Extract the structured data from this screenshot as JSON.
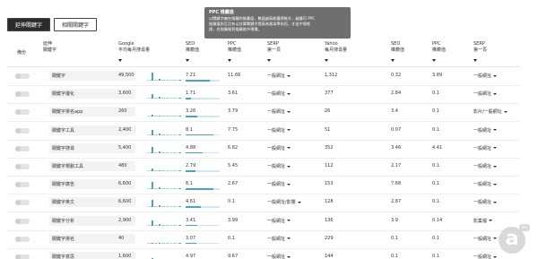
{
  "tabs": [
    {
      "label": "延伸關鍵字",
      "active": true
    },
    {
      "label": "相關關鍵字",
      "active": false
    }
  ],
  "tooltip": {
    "title": "PPC 推薦值",
    "lines": [
      "以關鍵字擁在推薦的推薦值，數值越高能獲得推升，越讓可 PPC",
      "推薦值和互比有以計算關鍵字提高為基本準則而，才出中發推",
      "銷，也指廣推到推薦推中現場。"
    ]
  },
  "headers": {
    "switch": "備份",
    "keyword": [
      "延伸",
      "關鍵字"
    ],
    "google": [
      "Google",
      "平均每月搜尋量"
    ],
    "seo1": [
      "SEO",
      "推薦值"
    ],
    "ppc1": [
      "PPC",
      "推薦值"
    ],
    "serp1": [
      "SERP",
      "第一頁"
    ],
    "yahoo": [
      "Yahoo",
      "每月搜尋量"
    ],
    "seo2": [
      "SEO",
      "推薦值"
    ],
    "ppc2": [
      "PPC",
      "推薦值"
    ],
    "serp2": [
      "SERP",
      "第一頁"
    ]
  },
  "rows": [
    {
      "keyword": "關鍵字",
      "google": "49,500",
      "seo1": "7.21",
      "ppc1": "11.66",
      "serp1": "一般網址",
      "yahoo": "1,312",
      "seo2": "0.32",
      "ppc2": "3.89",
      "serp2": "一般網址",
      "bar": 0.72
    },
    {
      "keyword": "關鍵字優化",
      "google": "3,600",
      "seo1": "1.71",
      "ppc1": "3.61",
      "serp1": "一般網址",
      "yahoo": "377",
      "seo2": "2.84",
      "ppc2": "0.1",
      "serp2": "一般網址",
      "bar": 0.17
    },
    {
      "keyword": "關鍵字排名app",
      "google": "260",
      "seo1": "3.26",
      "ppc1": "3.79",
      "serp1": "一般網址",
      "yahoo": "26",
      "seo2": "3.4",
      "ppc2": "0.1",
      "serp2": "影片/一般網址",
      "bar": 0.33
    },
    {
      "keyword": "關鍵字工具",
      "google": "2,400",
      "seo1": "8.1",
      "ppc1": "7.75",
      "serp1": "一般網址",
      "yahoo": "51",
      "seo2": "0.07",
      "ppc2": "0.1",
      "serp2": "一般網址",
      "bar": 0.81
    },
    {
      "keyword": "關鍵字搜尋",
      "google": "5,400",
      "seo1": "4.88",
      "ppc1": "6.82",
      "serp1": "一般網址",
      "yahoo": "352",
      "seo2": "3.46",
      "ppc2": "4.41",
      "serp2": "一般網址",
      "bar": 0.49
    },
    {
      "keyword": "關鍵字規劃工具",
      "google": "480",
      "seo1": "2.79",
      "ppc1": "5.45",
      "serp1": "一般網址",
      "yahoo": "112",
      "seo2": "2.17",
      "ppc2": "0.1",
      "serp2": "一般網址",
      "bar": 0.28
    },
    {
      "keyword": "關鍵字廣告",
      "google": "6,600",
      "seo1": "8.1",
      "ppc1": "2.67",
      "serp1": "一般網址",
      "yahoo": "153",
      "seo2": "7.68",
      "ppc2": "0.1",
      "serp2": "一般網址",
      "bar": 0.81
    },
    {
      "keyword": "關鍵字英文",
      "google": "6,600",
      "seo1": "4.61",
      "ppc1": "0.1",
      "serp1": "一般網址/影響",
      "yahoo": "128",
      "seo2": "2.87",
      "ppc2": "0.1",
      "serp2": "一般網址",
      "bar": 0.46
    },
    {
      "keyword": "關鍵字分析",
      "google": "2,900",
      "seo1": "3.41",
      "ppc1": "3.99",
      "serp1": "一般網址",
      "yahoo": "136",
      "seo2": "3.9",
      "ppc2": "0.14",
      "serp2": "影集檔",
      "bar": 0.34
    },
    {
      "keyword": "關鍵字排名",
      "google": "40",
      "seo1": "3.07",
      "ppc1": "0.1",
      "serp1": "一般網址",
      "yahoo": "229",
      "seo2": "0.1",
      "ppc2": "0.1",
      "serp2": "一般網址",
      "bar": 0.31
    },
    {
      "keyword": "關鍵字意思",
      "google": "1,600",
      "seo1": "4.97",
      "ppc1": "9.67",
      "serp1": "一般網址",
      "yahoo": "144",
      "seo2": "0.1",
      "ppc2": "0.1",
      "serp2": "一般網址",
      "bar": 0.5
    }
  ],
  "colors": {
    "accent": "#4aa3c6",
    "tab_active": "#2b2b2b",
    "tooltip": "#6f6f6f"
  },
  "logo": {
    "letter": "a",
    "tag": "iPai"
  }
}
